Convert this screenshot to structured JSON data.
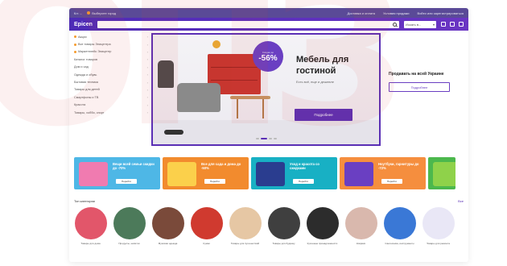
{
  "topbar": {
    "left_items": [
      "Кл: ...",
      "Выберите город"
    ],
    "right_items": [
      "Доставка и оплата",
      "Условия продажи",
      "Войти или зарегистрироваться"
    ]
  },
  "header": {
    "logo": "Epicen",
    "search_placeholder": "",
    "language_select": "Искать в..."
  },
  "sidebar": {
    "items": [
      {
        "label": "Акции",
        "bullet": "#f59b2e"
      },
      {
        "label": "Все товары Эпицентра",
        "bullet": "#f59b2e"
      },
      {
        "label": "Маркетплейс Эпицентр",
        "bullet": "#f59b2e"
      },
      {
        "label": "Каталог товаров",
        "bullet": ""
      },
      {
        "label": "Дом и сад",
        "bullet": ""
      },
      {
        "label": "Одежда и обувь",
        "bullet": ""
      },
      {
        "label": "Бытовая техника",
        "bullet": ""
      },
      {
        "label": "Товары для детей",
        "bullet": ""
      },
      {
        "label": "Смартфоны и ТВ",
        "bullet": ""
      },
      {
        "label": "Красота",
        "bullet": ""
      },
      {
        "label": "Товары, хобби, спорт",
        "bullet": ""
      }
    ]
  },
  "banner": {
    "badge_top": "Скидки до",
    "discount": "-56%",
    "title_line1": "Мебель для",
    "title_line2": "гостиной",
    "subtitle": "Есть всё, еще и дешевле",
    "cta": "Подробнее"
  },
  "sell": {
    "title": "Продавать на всей Украине",
    "cta": "Подробнее"
  },
  "promos": [
    {
      "title": "Вещи всей семьи скидки до -70%",
      "btn": "Перейти",
      "bg": "#4eb7e6",
      "art": "#f07bb0"
    },
    {
      "title": "Все для сада и дома до -50%",
      "btn": "Перейти",
      "bg": "#f28b2e",
      "art": "#fbd04b"
    },
    {
      "title": "Уход и красота со скидками",
      "btn": "Перейти",
      "bg": "#18b0c4",
      "art": "#2a3d8f"
    },
    {
      "title": "Ноутбуки, гарнитуры до -72%",
      "btn": "Перейти",
      "bg": "#f58e3e",
      "art": "#6a3fc2"
    },
    {
      "title": "",
      "btn": "",
      "bg": "#4cb84d",
      "art": "#8fd24a"
    }
  ],
  "categories": {
    "title": "Топ категории",
    "all_link": "Все",
    "items": [
      {
        "label": "Товары для дома",
        "color": "#e2566a"
      },
      {
        "label": "Продукты, напитки",
        "color": "#4c7a5a"
      },
      {
        "label": "Мужская одежда",
        "color": "#7a4a3a"
      },
      {
        "label": "Сумки",
        "color": "#d03a2f"
      },
      {
        "label": "Товары для путешествий",
        "color": "#e6c7a4"
      },
      {
        "label": "Товары для будинку",
        "color": "#3f3f3f"
      },
      {
        "label": "Кухонные принадлежности",
        "color": "#2c2c2c"
      },
      {
        "label": "Коврики",
        "color": "#d9b8ad"
      },
      {
        "label": "Сантехника, инструменты",
        "color": "#3a78d6"
      },
      {
        "label": "Товары для ремонта",
        "color": "#e9e7f6"
      }
    ]
  }
}
